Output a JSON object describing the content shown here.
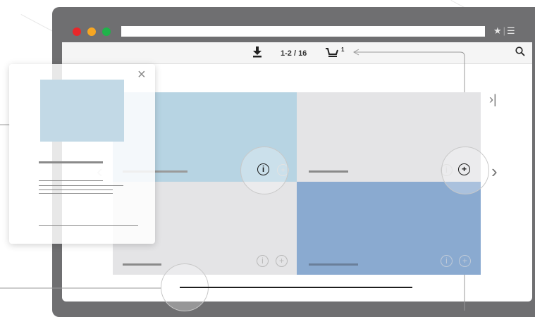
{
  "toolbar": {
    "page_counter": "1-2 / 16",
    "cart_count": "1"
  },
  "icons": {
    "download": "download-icon",
    "cart": "cart-icon",
    "search": "search-icon",
    "star": "star-icon",
    "menu": "menu-icon",
    "close": "close-icon",
    "info": "info-icon",
    "add": "add-icon",
    "next": "chevron-right-icon",
    "prev": "chevron-left-icon",
    "last": "last-page-icon"
  },
  "colors": {
    "frame": "#6f6f71",
    "tile_gray": "#e4e4e6",
    "tile_light_blue": "#b7d4e3",
    "tile_blue": "#8aaad0",
    "traffic_red": "#e8272a",
    "traffic_orange": "#f6a623",
    "traffic_green": "#1fb34a"
  }
}
